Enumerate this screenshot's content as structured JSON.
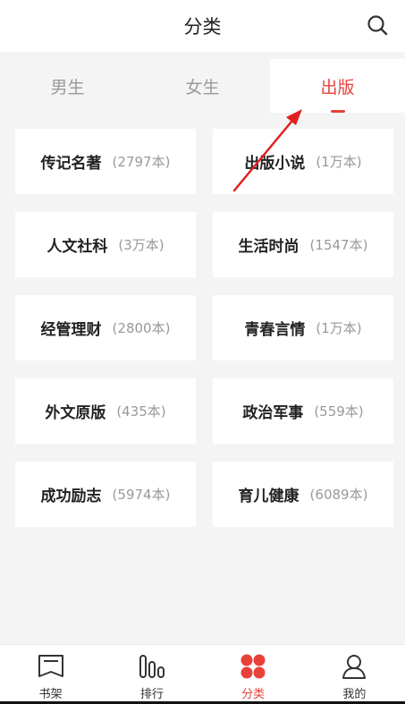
{
  "header": {
    "title": "分类"
  },
  "tabs": [
    {
      "label": "男生",
      "active": false
    },
    {
      "label": "女生",
      "active": false
    },
    {
      "label": "出版",
      "active": true
    }
  ],
  "categories": [
    {
      "name": "传记名著",
      "count": "(2797本)"
    },
    {
      "name": "出版小说",
      "count": "(1万本)"
    },
    {
      "name": "人文社科",
      "count": "(3万本)"
    },
    {
      "name": "生活时尚",
      "count": "(1547本)"
    },
    {
      "name": "经管理财",
      "count": "(2800本)"
    },
    {
      "name": "青春言情",
      "count": "(1万本)"
    },
    {
      "name": "外文原版",
      "count": "(435本)"
    },
    {
      "name": "政治军事",
      "count": "(559本)"
    },
    {
      "name": "成功励志",
      "count": "(5974本)"
    },
    {
      "name": "育儿健康",
      "count": "(6089本)"
    }
  ],
  "nav": [
    {
      "label": "书架",
      "icon": "bookshelf-icon",
      "active": false
    },
    {
      "label": "排行",
      "icon": "ranking-icon",
      "active": false
    },
    {
      "label": "分类",
      "icon": "category-icon",
      "active": true
    },
    {
      "label": "我的",
      "icon": "profile-icon",
      "active": false
    }
  ],
  "colors": {
    "accent": "#e8413a",
    "background": "#f4f4f4",
    "card": "#ffffff",
    "muted_text": "#999999"
  }
}
